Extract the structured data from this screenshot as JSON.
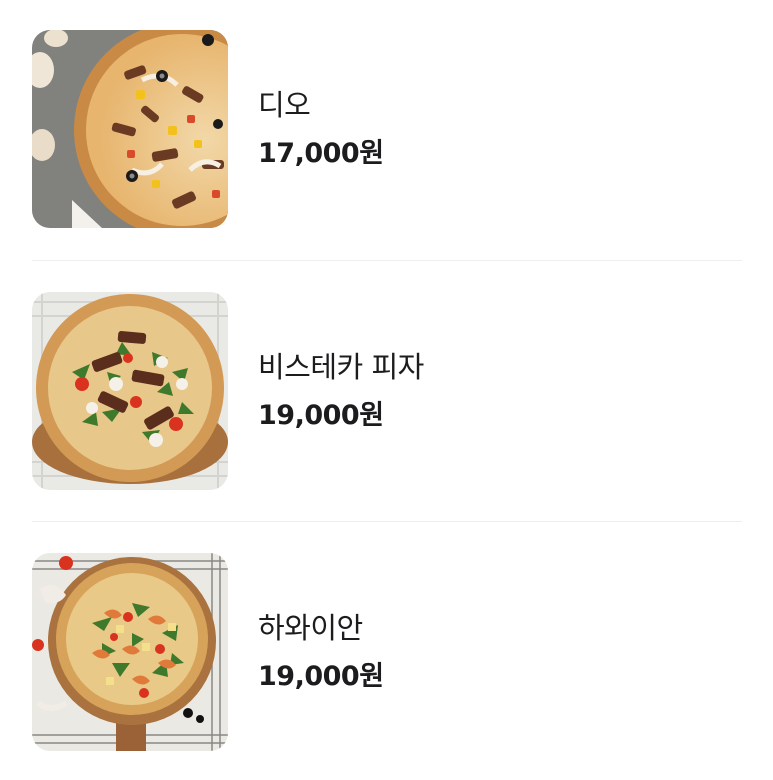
{
  "menu": {
    "items": [
      {
        "name": "디오",
        "price": "17,000원",
        "image_icon": "pizza-dio-photo"
      },
      {
        "name": "비스테카 피자",
        "price": "19,000원",
        "image_icon": "pizza-bistecca-photo"
      },
      {
        "name": "하와이안",
        "price": "19,000원",
        "image_icon": "pizza-hawaiian-photo"
      }
    ]
  },
  "colors": {
    "text": "#1c1c1e",
    "divider": "#eeeeee",
    "background": "#ffffff"
  }
}
